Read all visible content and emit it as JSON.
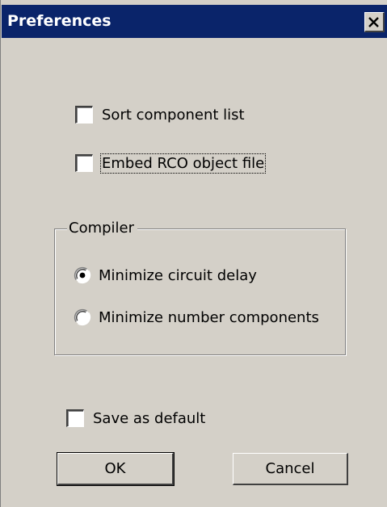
{
  "window": {
    "title": "Preferences",
    "close_icon": "close-icon"
  },
  "options": {
    "sort_component_list": {
      "label": "Sort component list",
      "checked": false
    },
    "embed_rco_object_file": {
      "label": "Embed RCO object file",
      "checked": false
    }
  },
  "compiler": {
    "legend": "Compiler",
    "selected": "Minimize circuit delay",
    "options": [
      {
        "label": "Minimize circuit delay",
        "selected": true
      },
      {
        "label": "Minimize number components",
        "selected": false
      }
    ]
  },
  "save_as_default": {
    "label": "Save as default",
    "checked": false
  },
  "buttons": {
    "ok": "OK",
    "cancel": "Cancel"
  },
  "colors": {
    "titlebar": "#0a246a",
    "face": "#d4d0c8"
  }
}
